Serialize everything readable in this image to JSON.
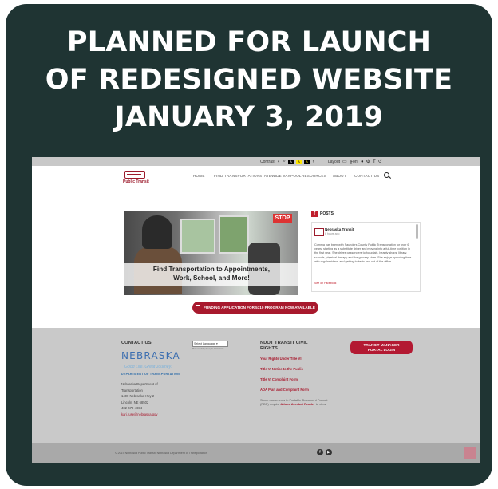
{
  "headline": {
    "line1": "PLANNED FOR LAUNCH",
    "line2": "OF REDESIGNED WEBSITE",
    "line3": "JANUARY 3, 2019"
  },
  "accessibility_bar": {
    "contrast_label": "Contrast",
    "layout_label": "Layout",
    "font_label": "Font",
    "contrast_swatches": [
      "#000000",
      "#ffe600",
      "#000000"
    ]
  },
  "nav": {
    "logo_text": "Public Transit",
    "items": [
      "HOME",
      "FIND TRANSPORTATION",
      "STATEWIDE VANPOOL",
      "RESOURCES",
      "ABOUT",
      "CONTACT US"
    ]
  },
  "hero": {
    "caption_line1": "Find Transportation to Appointments,",
    "caption_line2": "Work, School, and More!",
    "sign_text": "STOP"
  },
  "posts": {
    "title": "POSTS",
    "author": "Nebraska Transit",
    "time": "6 hours ago",
    "body": "Comma has been with Saunders County Public Transportation for over 6 years, starting as a substitute driver and moving into a full-time position in the first year. She drives passengers to hospitals, beauty shops, library, schools, physical therapy and the grocery store. She enjoys spending time with regular riders, and getting to be in and out of the office.",
    "more_link": "See on Facebook"
  },
  "cta": {
    "label": "FUNDING APPLICATION FOR 5310 PROGRAM NOW AVAILABLE"
  },
  "footer": {
    "contact_heading": "CONTACT US",
    "language_select": "Select Language",
    "powered_by": "Powered by Google Translate",
    "nebraska": "NEBRASKA",
    "tagline": "Good Life. Great Journey.",
    "dept": "DEPARTMENT OF TRANSPORTATION",
    "address_lines": [
      "Nebraska Department of",
      "Transportation",
      "1400 Nebraska Hwy 2",
      "Lincoln, NE 68502",
      "402-479-4694"
    ],
    "email": "kari.ruse@nebraska.gov",
    "civil_heading_line1": "NDOT TRANSIT CIVIL",
    "civil_heading_line2": "RIGHTS",
    "links": [
      "Your Rights Under Title VI",
      "Title VI Notice to the Public",
      "Title VI Complaint Form",
      "ADA Plan and Complaint Form"
    ],
    "note_prefix": "Some documents in Portable Document Format (PDF) require",
    "note_link": "Adobe Acrobat Reader",
    "note_suffix": "to view.",
    "portal_line1": "TRANSIT MANAGER",
    "portal_line2": "PORTAL LOGIN"
  },
  "bottom_bar": {
    "copyright": "© 2019 Nebraska Public Transit, Nebraska Department of Transportation"
  }
}
